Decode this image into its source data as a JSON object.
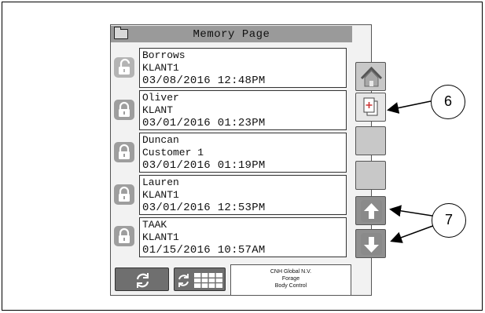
{
  "title": "Memory Page",
  "entries": [
    {
      "name": "Borrows",
      "customer": "KLANT1",
      "datetime": "03/08/2016 12:48PM",
      "lock": "unlocked"
    },
    {
      "name": "Oliver",
      "customer": "KLANT",
      "datetime": "03/01/2016 01:23PM",
      "lock": "locked"
    },
    {
      "name": "Duncan",
      "customer": "Customer 1",
      "datetime": "03/01/2016 01:19PM",
      "lock": "locked"
    },
    {
      "name": "Lauren",
      "customer": "KLANT1",
      "datetime": "03/01/2016 12:53PM",
      "lock": "locked"
    },
    {
      "name": "TAAK",
      "customer": "KLANT1",
      "datetime": "01/15/2016 10:57AM",
      "lock": "locked"
    }
  ],
  "side_buttons": [
    "home-icon",
    "add-document-icon",
    "blank",
    "blank",
    "arrow-up-icon",
    "arrow-down-icon"
  ],
  "bottom_buttons": [
    "refresh-icon",
    "refresh-grid-icon"
  ],
  "company": {
    "line1": "CNH Global N.V.",
    "line2": "Forage",
    "line3": "Body Control"
  },
  "callouts": {
    "add": "6",
    "scroll": "7"
  }
}
